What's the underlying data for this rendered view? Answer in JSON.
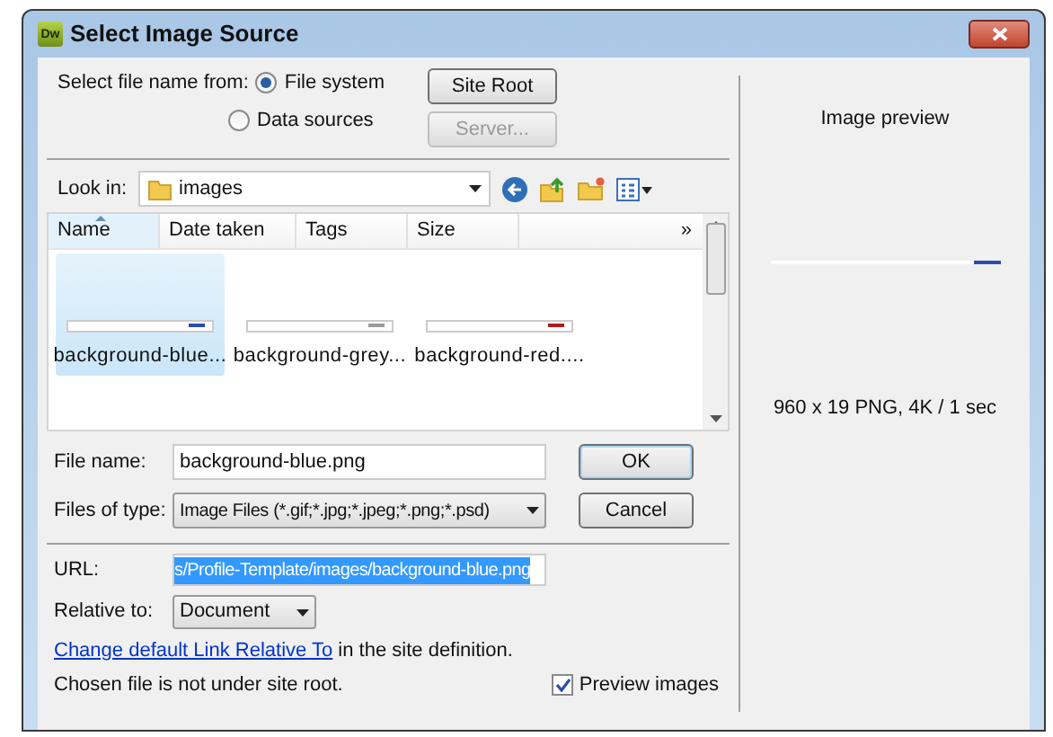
{
  "window": {
    "title": "Select Image Source",
    "app_badge": "Dw"
  },
  "source": {
    "label": "Select file name from:",
    "options": [
      {
        "label": "File system",
        "selected": true
      },
      {
        "label": "Data sources",
        "selected": false
      }
    ]
  },
  "side_buttons": [
    {
      "label": "Site Root",
      "disabled": false
    },
    {
      "label": "Server...",
      "disabled": true
    }
  ],
  "look_in": {
    "label": "Look in:",
    "value": "images"
  },
  "file_list": {
    "columns": [
      {
        "label": "Name",
        "sorted": true
      },
      {
        "label": "Date taken",
        "sorted": false
      },
      {
        "label": "Tags",
        "sorted": false
      },
      {
        "label": "Size",
        "sorted": false
      }
    ],
    "more": "»",
    "files": [
      {
        "name": "background-blue...",
        "selected": true,
        "color": "#2a4fa8"
      },
      {
        "name": "background-grey...",
        "selected": false,
        "color": "#9a9a9a"
      },
      {
        "name": "background-red....",
        "selected": false,
        "color": "#b01c1c"
      }
    ]
  },
  "file_name": {
    "label": "File name:",
    "value": "background-blue.png"
  },
  "files_of_type": {
    "label": "Files of type:",
    "value": "Image Files (*.gif;*.jpg;*.jpeg;*.png;*.psd)"
  },
  "ok_button": "OK",
  "cancel_button": "Cancel",
  "url": {
    "label": "URL:",
    "value": "s/Profile-Template/images/background-blue.png"
  },
  "relative_to": {
    "label": "Relative to:",
    "value": "Document"
  },
  "link_line": {
    "link": "Change default Link Relative To",
    "rest": " in the site definition."
  },
  "status": "Chosen file is not under site root.",
  "preview_checkbox": {
    "label": "Preview images",
    "checked": true
  },
  "preview": {
    "title": "Image preview",
    "info": "960 x 19 PNG, 4K / 1 sec",
    "color": "#2a4fa8"
  }
}
